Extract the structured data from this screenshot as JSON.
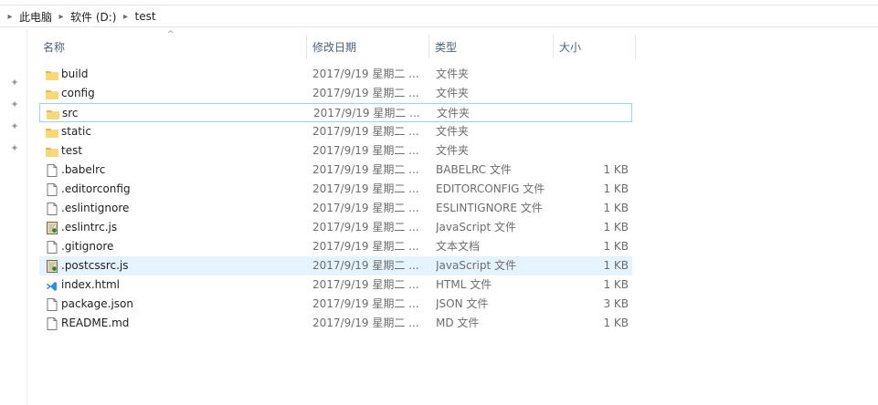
{
  "breadcrumb": [
    "此电脑",
    "软件 (D:)",
    "test"
  ],
  "columns": {
    "name": "名称",
    "date": "修改日期",
    "type": "类型",
    "size": "大小"
  },
  "sort_indicator": "^",
  "colors": {
    "folder": "#f8d775",
    "folder_dark": "#e3b949",
    "hover_bg": "#e5f3ff",
    "focus_border": "#99d1ff",
    "header_text": "#4c607a"
  },
  "files": [
    {
      "name": "build",
      "date": "2017/9/19 星期二 ...",
      "type": "文件夹",
      "size": "",
      "icon": "folder-icon"
    },
    {
      "name": "config",
      "date": "2017/9/19 星期二 ...",
      "type": "文件夹",
      "size": "",
      "icon": "folder-icon"
    },
    {
      "name": "src",
      "date": "2017/9/19 星期二 ...",
      "type": "文件夹",
      "size": "",
      "icon": "folder-icon"
    },
    {
      "name": "static",
      "date": "2017/9/19 星期二 ...",
      "type": "文件夹",
      "size": "",
      "icon": "folder-icon"
    },
    {
      "name": "test",
      "date": "2017/9/19 星期二 ...",
      "type": "文件夹",
      "size": "",
      "icon": "folder-icon"
    },
    {
      "name": ".babelrc",
      "date": "2017/9/19 星期二 ...",
      "type": "BABELRC 文件",
      "size": "1 KB",
      "icon": "document-icon"
    },
    {
      "name": ".editorconfig",
      "date": "2017/9/19 星期二 ...",
      "type": "EDITORCONFIG 文件",
      "size": "1 KB",
      "icon": "document-icon"
    },
    {
      "name": ".eslintignore",
      "date": "2017/9/19 星期二 ...",
      "type": "ESLINTIGNORE 文件",
      "size": "1 KB",
      "icon": "document-icon"
    },
    {
      "name": ".eslintrc.js",
      "date": "2017/9/19 星期二 ...",
      "type": "JavaScript 文件",
      "size": "1 KB",
      "icon": "script-icon"
    },
    {
      "name": ".gitignore",
      "date": "2017/9/19 星期二 ...",
      "type": "文本文档",
      "size": "1 KB",
      "icon": "document-icon"
    },
    {
      "name": ".postcssrc.js",
      "date": "2017/9/19 星期二 ...",
      "type": "JavaScript 文件",
      "size": "1 KB",
      "icon": "script-icon"
    },
    {
      "name": "index.html",
      "date": "2017/9/19 星期二 ...",
      "type": "HTML 文件",
      "size": "1 KB",
      "icon": "vscode-icon"
    },
    {
      "name": "package.json",
      "date": "2017/9/19 星期二 ...",
      "type": "JSON 文件",
      "size": "3 KB",
      "icon": "document-icon"
    },
    {
      "name": "README.md",
      "date": "2017/9/19 星期二 ...",
      "type": "MD 文件",
      "size": "1 KB",
      "icon": "document-icon"
    }
  ],
  "focused_row": 2,
  "hover_row": 10
}
